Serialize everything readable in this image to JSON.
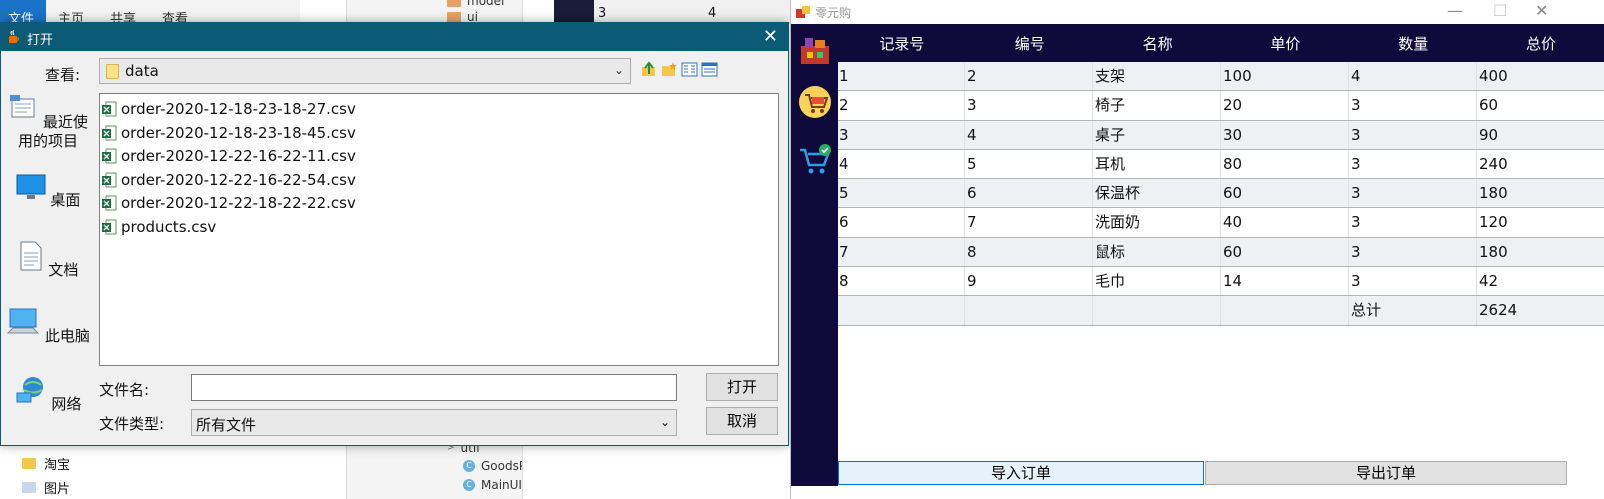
{
  "background": {
    "explorer_ribbon": [
      "文件",
      "主页",
      "共享",
      "查看"
    ],
    "explorer_nav": [
      "淘宝",
      "图片"
    ],
    "ide_tree_top": [
      "model",
      "ui"
    ],
    "ide_tree_bottom": [
      "util",
      "GoodsP",
      "MainUI"
    ],
    "table_fragment": [
      "3",
      "4"
    ]
  },
  "dialog": {
    "title": "打开",
    "close_glyph": "✕",
    "look_in_label": "查看:",
    "look_in_value": "data",
    "places": [
      {
        "label": "最近使用的项目",
        "icon": "recent-items-icon"
      },
      {
        "label": "桌面",
        "icon": "desktop-icon"
      },
      {
        "label": "文档",
        "icon": "documents-icon"
      },
      {
        "label": "此电脑",
        "icon": "this-pc-icon"
      },
      {
        "label": "网络",
        "icon": "network-icon"
      }
    ],
    "files": [
      "order-2020-12-18-23-18-27.csv",
      "order-2020-12-18-23-18-45.csv",
      "order-2020-12-22-16-22-11.csv",
      "order-2020-12-22-16-22-54.csv",
      "order-2020-12-22-18-22-22.csv",
      "products.csv"
    ],
    "filename_label": "文件名:",
    "filename_value": "",
    "filetype_label": "文件类型:",
    "filetype_value": "所有文件",
    "open_button": "打开",
    "cancel_button": "取消"
  },
  "app": {
    "title": "零元购",
    "columns": [
      "记录号",
      "编号",
      "名称",
      "单价",
      "数量",
      "总价"
    ],
    "rows": [
      [
        "1",
        "2",
        "支架",
        "100",
        "4",
        "400"
      ],
      [
        "2",
        "3",
        "椅子",
        "20",
        "3",
        "60"
      ],
      [
        "3",
        "4",
        "桌子",
        "30",
        "3",
        "90"
      ],
      [
        "4",
        "5",
        "耳机",
        "80",
        "3",
        "240"
      ],
      [
        "5",
        "6",
        "保温杯",
        "60",
        "3",
        "180"
      ],
      [
        "6",
        "7",
        "洗面奶",
        "40",
        "3",
        "120"
      ],
      [
        "7",
        "8",
        "鼠标",
        "60",
        "3",
        "180"
      ],
      [
        "8",
        "9",
        "毛巾",
        "14",
        "3",
        "42"
      ]
    ],
    "total_row": [
      "",
      "",
      "",
      "",
      "总计",
      "2624"
    ],
    "import_button": "导入订单",
    "export_button": "导出订单",
    "colors": {
      "sidebar": "#10093b",
      "header": "#10093b",
      "dialog_title": "#0b5a76"
    }
  }
}
